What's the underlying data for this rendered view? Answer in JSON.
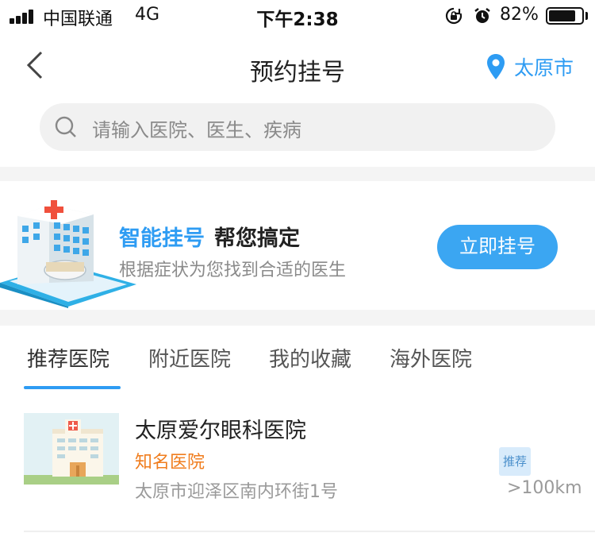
{
  "status_bar": {
    "carrier": "中国联通",
    "network": "4G",
    "time": "下午2:38",
    "battery_percent": "82%",
    "battery_level": 0.82
  },
  "nav": {
    "title": "预约挂号",
    "location": "太原市",
    "icons": {
      "back": "chevron-left-icon",
      "location": "map-pin-icon"
    }
  },
  "search": {
    "placeholder": "请输入医院、医生、疾病",
    "icon": "search-icon"
  },
  "banner": {
    "title_accent": "智能挂号",
    "title_rest": "帮您搞定",
    "subtitle": "根据症状为您找到合适的医生",
    "cta_label": "立即挂号"
  },
  "tabs": [
    {
      "label": "推荐医院",
      "active": true
    },
    {
      "label": "附近医院",
      "active": false
    },
    {
      "label": "我的收藏",
      "active": false
    },
    {
      "label": "海外医院",
      "active": false
    }
  ],
  "hospitals": [
    {
      "name": "太原爱尔眼科医院",
      "grade": "知名医院",
      "address": "太原市迎泽区南内环街1号",
      "badge": "推荐",
      "distance": ">100km"
    }
  ],
  "colors": {
    "accent": "#2e9cf3",
    "cta": "#3ba6f2",
    "grade": "#f07d1e",
    "muted": "#9a9a9a"
  }
}
